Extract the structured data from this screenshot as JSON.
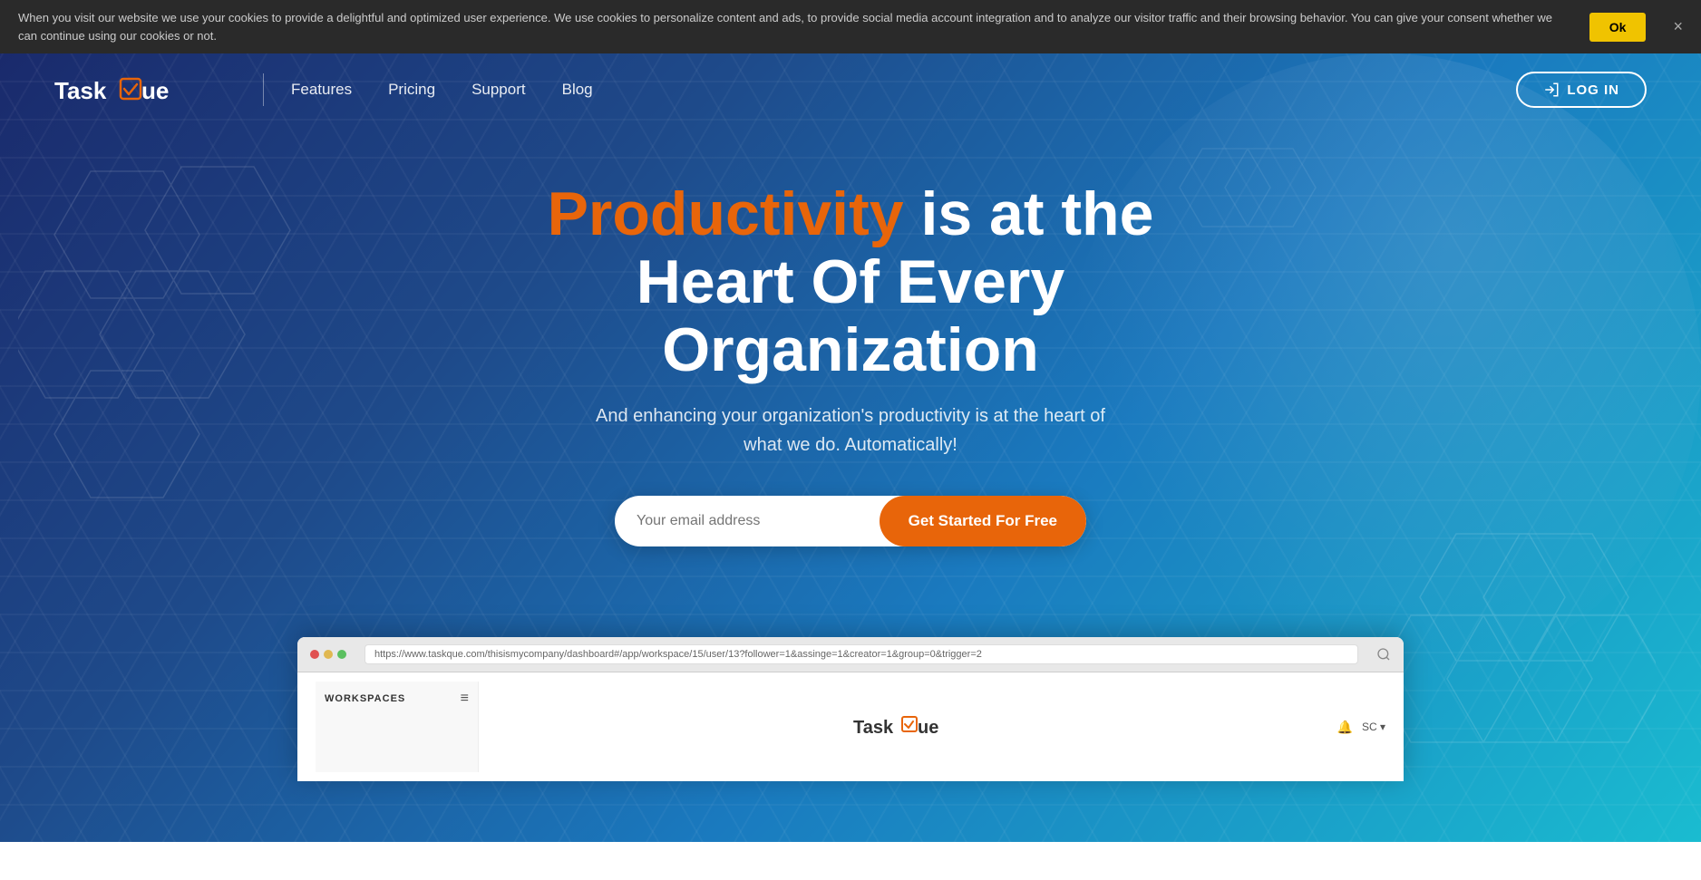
{
  "cookie": {
    "text": "When you visit our website we use your cookies to provide a delightful and optimized user experience. We use cookies to personalize content and ads, to provide social media account integration and to analyze our visitor traffic and their browsing behavior. You can give your consent whether we can continue using our cookies or not.",
    "ok_label": "Ok",
    "close": "×"
  },
  "navbar": {
    "logo_word1": "Task",
    "logo_word2": "ue",
    "links": [
      {
        "label": "Features"
      },
      {
        "label": "Pricing"
      },
      {
        "label": "Support"
      },
      {
        "label": "Blog"
      }
    ],
    "login_label": "LOG IN"
  },
  "hero": {
    "title_orange": "Productivity",
    "title_rest": " is at the",
    "title_line2": "Heart Of Every Organization",
    "subtitle": "And enhancing your organization's productivity is at the heart of what we do. Automatically!",
    "email_placeholder": "Your email address",
    "cta_label": "Get Started For Free"
  },
  "browser": {
    "url": "https://www.taskque.com/thisismycompany/dashboard#/app/workspace/15/user/13?follower=1&assinge=1&creator=1&group=0&trigger=2",
    "sidebar_title": "WORKSPACES",
    "logo_word1": "Task",
    "logo_word2": "ue",
    "menu_icon": "≡",
    "bell_icon": "🔔",
    "sc_label": "SC ▾"
  },
  "colors": {
    "orange": "#e8650a",
    "dark_blue": "#1a2a6c",
    "mid_blue": "#1e4a8a",
    "light_blue": "#1abcd0",
    "white": "#ffffff",
    "cookie_bg": "#2a2a2a",
    "yellow_btn": "#f0c300"
  }
}
